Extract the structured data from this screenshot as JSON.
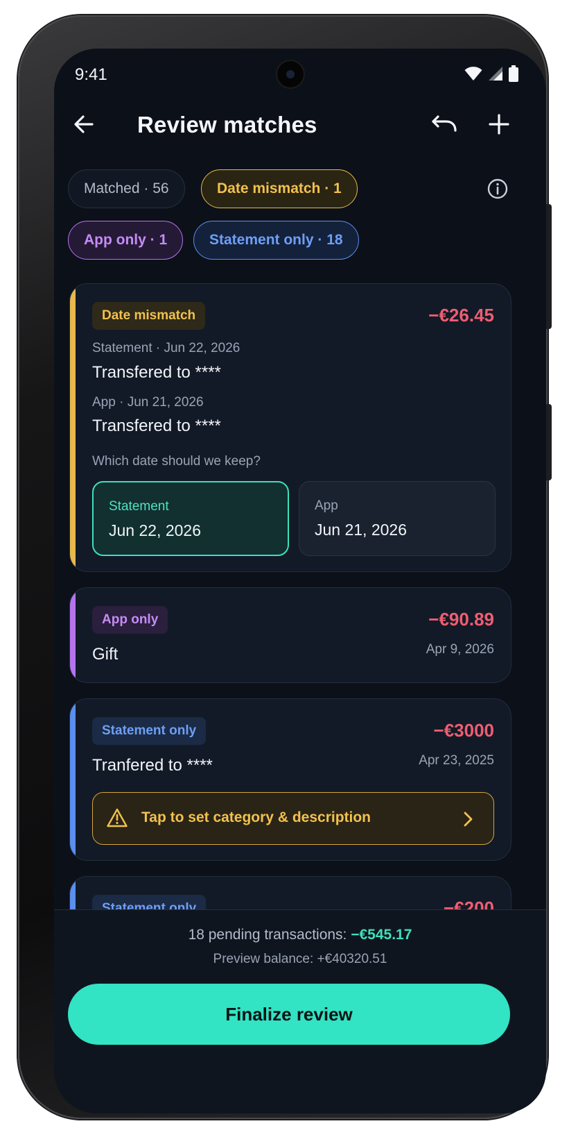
{
  "status": {
    "time": "9:41"
  },
  "header": {
    "title": "Review matches"
  },
  "filters": {
    "matched": "Matched · 56",
    "date_mismatch": "Date mismatch · 1",
    "app_only": "App only · 1",
    "statement_only": "Statement only · 18"
  },
  "cards": [
    {
      "badge": "Date mismatch",
      "amount": "−€26.45",
      "statement_meta": "Statement · Jun 22, 2026",
      "statement_desc": "Transfered to ****",
      "app_meta": "App · Jun 21, 2026",
      "app_desc": "Transfered to ****",
      "question": "Which date should we keep?",
      "options": [
        {
          "label": "Statement",
          "value": "Jun 22, 2026",
          "selected": true
        },
        {
          "label": "App",
          "value": "Jun 21, 2026",
          "selected": false
        }
      ]
    },
    {
      "badge": "App only",
      "amount": "−€90.89",
      "desc": "Gift",
      "date": "Apr 9, 2026"
    },
    {
      "badge": "Statement only",
      "amount": "−€3000",
      "desc": "Tranfered to ****",
      "date": "Apr 23, 2025",
      "warning": "Tap to set category & description"
    },
    {
      "badge": "Statement only",
      "amount": "−€200"
    }
  ],
  "summary": {
    "pending_label": "18 pending transactions: ",
    "pending_amount": "−€545.17",
    "preview": "Preview balance: +€40320.51",
    "cta": "Finalize review"
  },
  "colors": {
    "background": "#0c1018",
    "card": "#121a27",
    "accent_teal": "#32e3c4",
    "date_mismatch": "#e6b84d",
    "app_only": "#b574ee",
    "statement_only": "#5a8ff0",
    "negative_amount": "#ef5d72"
  },
  "icons": [
    "back-arrow-icon",
    "undo-icon",
    "plus-icon",
    "info-icon",
    "warning-icon",
    "chevron-right-icon",
    "wifi-icon",
    "signal-icon",
    "battery-icon"
  ]
}
